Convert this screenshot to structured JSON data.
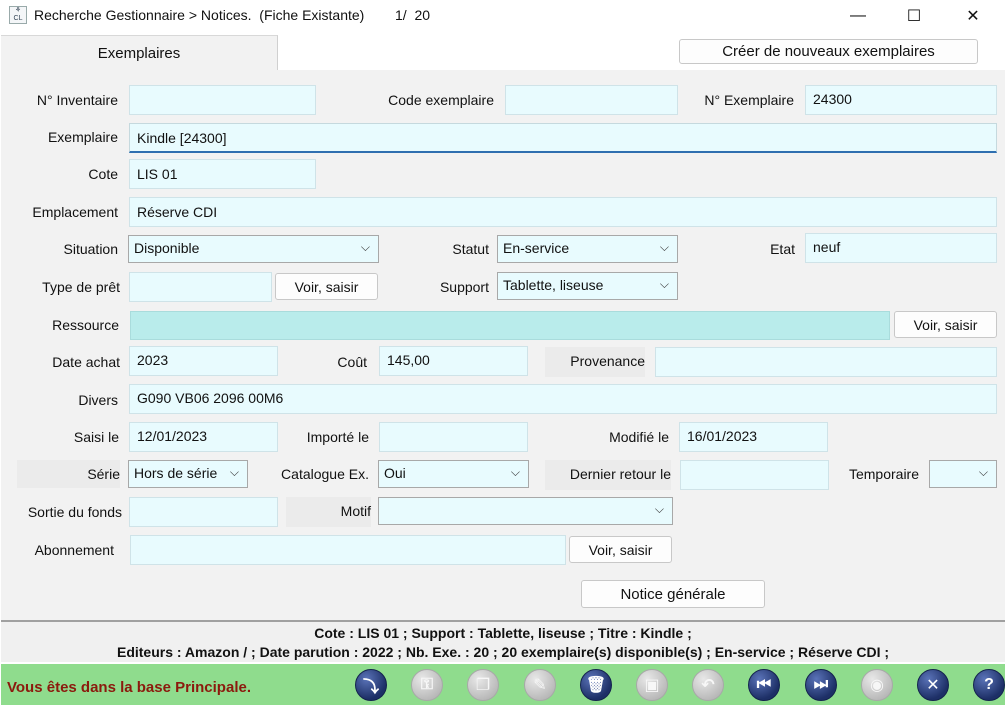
{
  "window": {
    "title": "Recherche Gestionnaire > Notices.  (Fiche Existante)",
    "position": "1/  20",
    "minimize_glyph": "—",
    "maximize_glyph": "☐",
    "close_glyph": "✕"
  },
  "tabs": {
    "active": "Exemplaires",
    "create_button": "Créer de nouveaux exemplaires"
  },
  "form": {
    "inventaire": {
      "label": "N° Inventaire",
      "value": ""
    },
    "code_exemplaire": {
      "label": "Code exemplaire",
      "value": ""
    },
    "num_exemplaire": {
      "label": "N° Exemplaire",
      "value": "24300"
    },
    "exemplaire": {
      "label": "Exemplaire",
      "value": "Kindle [24300]"
    },
    "cote": {
      "label": "Cote",
      "value": "LIS 01"
    },
    "emplacement": {
      "label": "Emplacement",
      "value": "Réserve CDI"
    },
    "situation": {
      "label": "Situation",
      "value": "Disponible"
    },
    "statut": {
      "label": "Statut",
      "value": "En-service"
    },
    "etat": {
      "label": "Etat",
      "value": "neuf"
    },
    "type_pret": {
      "label": "Type de prêt",
      "value": "",
      "button": "Voir, saisir"
    },
    "support": {
      "label": "Support",
      "value": "Tablette, liseuse"
    },
    "ressource": {
      "label": "Ressource",
      "value": "",
      "button": "Voir, saisir"
    },
    "date_achat": {
      "label": "Date achat",
      "value": "2023"
    },
    "cout": {
      "label": "Coût",
      "value": "145,00"
    },
    "provenance": {
      "label": "Provenance",
      "value": ""
    },
    "divers": {
      "label": "Divers",
      "value": "G090 VB06 2096 00M6"
    },
    "saisi_le": {
      "label": "Saisi le",
      "value": "12/01/2023"
    },
    "importe_le": {
      "label": "Importé le",
      "value": ""
    },
    "modifie_le": {
      "label": "Modifié le",
      "value": "16/01/2023"
    },
    "serie": {
      "label": "Série",
      "value": "Hors de série"
    },
    "catalogue": {
      "label": "Catalogue Ex.",
      "value": "Oui"
    },
    "dernier_retour": {
      "label": "Dernier retour le",
      "value": ""
    },
    "temporaire": {
      "label": "Temporaire",
      "value": ""
    },
    "sortie_fonds": {
      "label": "Sortie du fonds",
      "value": ""
    },
    "motif": {
      "label": "Motif",
      "value": ""
    },
    "abonnement": {
      "label": "Abonnement",
      "value": "",
      "button": "Voir, saisir"
    },
    "notice_button": "Notice générale"
  },
  "info_bar": {
    "line1": "Cote  : LIS 01 ;  Support  : Tablette, liseuse ;  Titre  : Kindle ;",
    "line2": "Editeurs  : Amazon / ;  Date parution  : 2022 ;  Nb. Exe.  : 20 ; 20 exemplaire(s) disponible(s)  ;  En-service ;  Réserve CDI ;"
  },
  "status_bar": {
    "message": "Vous êtes dans la base Principale.",
    "toolbar": [
      {
        "name": "save-to-base-icon",
        "glyph": "⤵",
        "enabled": true
      },
      {
        "name": "key-icon",
        "glyph": "⚿",
        "enabled": false
      },
      {
        "name": "copy-icon",
        "glyph": "❐",
        "enabled": false
      },
      {
        "name": "edit-icon",
        "glyph": "✎",
        "enabled": false
      },
      {
        "name": "trash-icon",
        "glyph": "🗑",
        "enabled": true
      },
      {
        "name": "disk-icon",
        "glyph": "▣",
        "enabled": false
      },
      {
        "name": "undo-icon",
        "glyph": "↶",
        "enabled": false
      },
      {
        "name": "first-record-icon",
        "glyph": "⏮",
        "enabled": true
      },
      {
        "name": "next-record-icon",
        "glyph": "⏭",
        "enabled": true
      },
      {
        "name": "eye-icon",
        "glyph": "◉",
        "enabled": false
      },
      {
        "name": "close-circle-icon",
        "glyph": "✕",
        "enabled": true
      },
      {
        "name": "help-icon",
        "glyph": "?",
        "enabled": true
      }
    ]
  },
  "colors": {
    "field_bg": "#e8fbfe",
    "resource_bg": "#b9eceb",
    "status_bg": "#8fdc8d",
    "status_text": "#8b1a0d",
    "icon_active": "#1d2f66"
  }
}
